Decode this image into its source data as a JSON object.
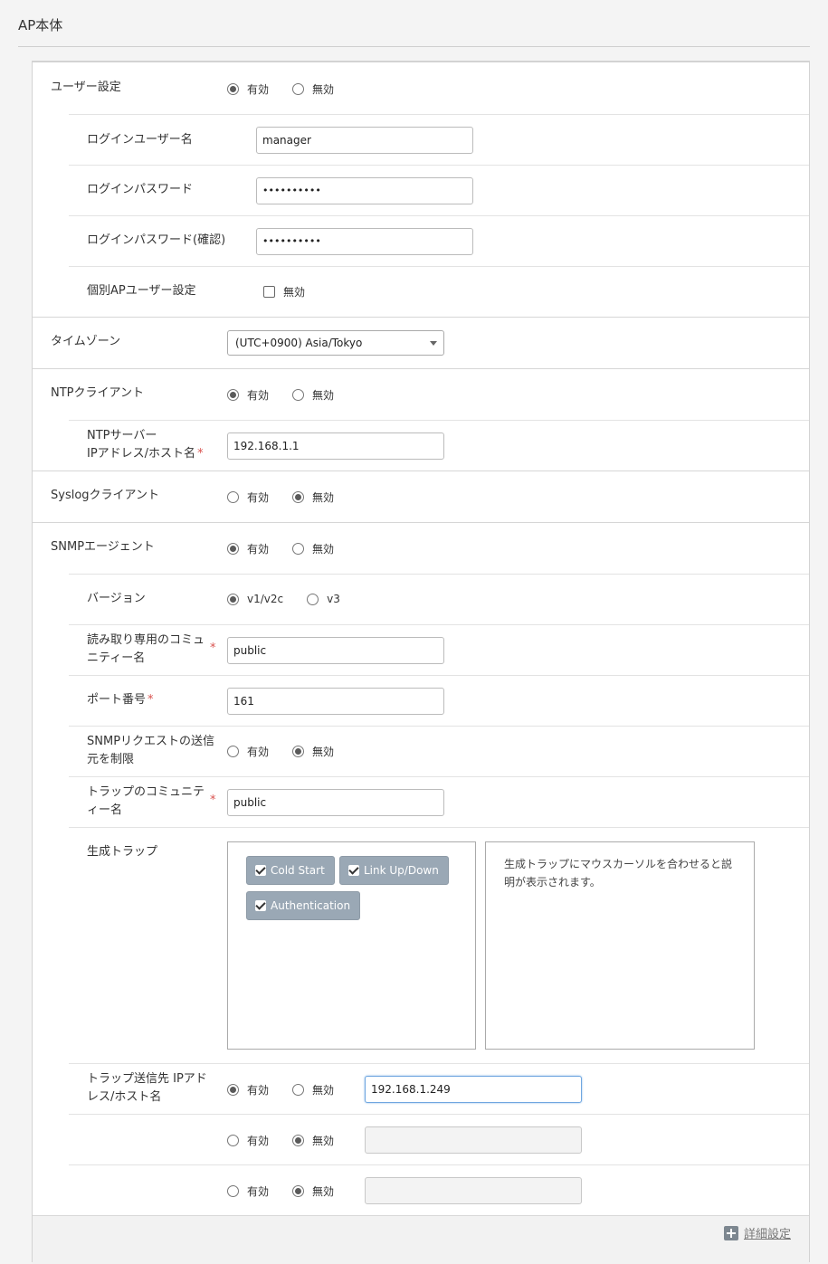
{
  "page": {
    "title": "AP本体"
  },
  "footer": {
    "detail_label": "詳細設定"
  },
  "user_settings": {
    "label": "ユーザー設定",
    "enabled_label": "有効",
    "disabled_label": "無効",
    "selected": "有効",
    "login_user_label": "ログインユーザー名",
    "login_user_value": "manager",
    "login_password_label": "ログインパスワード",
    "login_password_value": "••••••••••",
    "login_password_confirm_label": "ログインパスワード(確認)",
    "login_password_confirm_value": "••••••••••",
    "individual_ap_label": "個別APユーザー設定",
    "individual_ap_checkbox_label": "無効",
    "individual_ap_checked": false
  },
  "timezone": {
    "label": "タイムゾーン",
    "selected": "(UTC+0900) Asia/Tokyo"
  },
  "ntp": {
    "label": "NTPクライアント",
    "enabled_label": "有効",
    "disabled_label": "無効",
    "selected": "有効",
    "server_label_line1": "NTPサーバー",
    "server_label_line2": "IPアドレス/ホスト名",
    "server_value": "192.168.1.1"
  },
  "syslog": {
    "label": "Syslogクライアント",
    "enabled_label": "有効",
    "disabled_label": "無効",
    "selected": "無効"
  },
  "snmp": {
    "label": "SNMPエージェント",
    "enabled_label": "有効",
    "disabled_label": "無効",
    "selected": "有効",
    "version_label": "バージョン",
    "version_options": [
      "v1/v2c",
      "v3"
    ],
    "version_selected": "v1/v2c",
    "ro_community_label_line1": "読み取り専用のコミュ",
    "ro_community_label_line2": "ニティー名",
    "ro_community_value": "public",
    "port_label": "ポート番号",
    "port_value": "161",
    "restrict_label_line1": "SNMPリクエストの送信",
    "restrict_label_line2": "元を制限",
    "restrict_selected": "無効",
    "trap_community_label_line1": "トラップのコミュニテ",
    "trap_community_label_line2": "ィー名",
    "trap_community_value": "public",
    "traps_label": "生成トラップ",
    "traps": [
      {
        "label": "Cold Start",
        "checked": true
      },
      {
        "label": "Link Up/Down",
        "checked": true
      },
      {
        "label": "Authentication",
        "checked": true
      }
    ],
    "trap_description": "生成トラップにマウスカーソルを合わせると説明が表示されます。",
    "trap_dest_label_line1": "トラップ送信先 IPアド",
    "trap_dest_label_line2": "レス/ホスト名",
    "trap_destinations": [
      {
        "selected": "有効",
        "value": "192.168.1.249"
      },
      {
        "selected": "無効",
        "value": ""
      },
      {
        "selected": "無効",
        "value": ""
      }
    ]
  }
}
